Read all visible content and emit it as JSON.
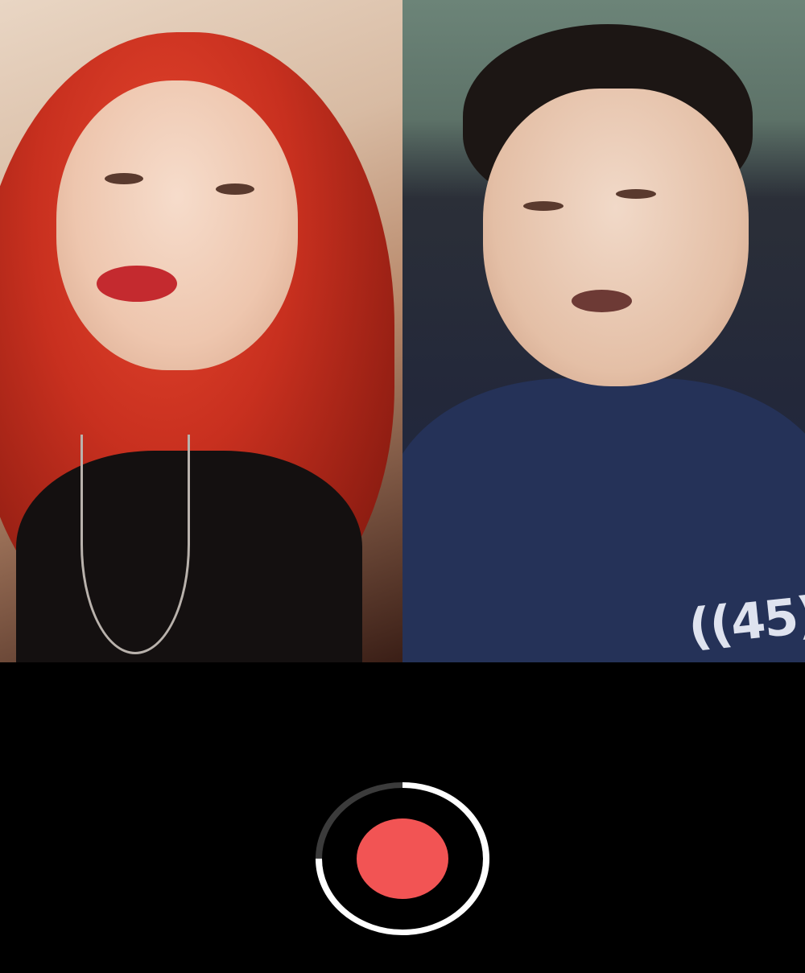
{
  "feeds": {
    "left": {
      "label": ""
    },
    "right": {
      "shirt_text": "((45)"
    }
  },
  "recorder": {
    "icon": "record-icon",
    "progress": 0.25,
    "colors": {
      "dot": "#f25454",
      "ring_fill": "#ffffff",
      "ring_track": "#3b3b3b",
      "background": "#000000"
    }
  }
}
